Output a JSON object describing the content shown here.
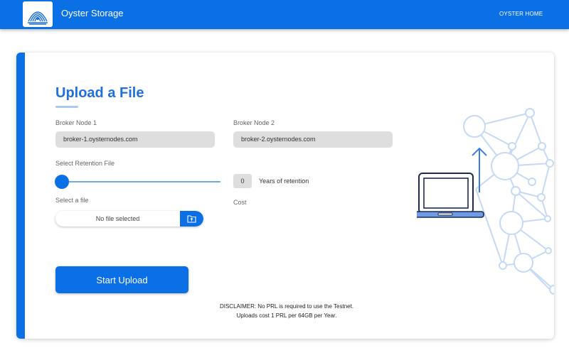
{
  "app": {
    "brand": "Oyster Storage",
    "home_link": "OYSTER HOME",
    "logo_icon": "oyster-logo"
  },
  "form": {
    "title": "Upload a File",
    "broker1_label": "Broker Node 1",
    "broker1_value": "broker-1.oysternodes.com",
    "broker2_label": "Broker Node 2",
    "broker2_value": "broker-2.oysternodes.com",
    "retention_label": "Select Retention File",
    "retention_value": 0,
    "years": "0",
    "years_label": "Years of retention",
    "select_file_label": "Select a file",
    "file_status": "No file selected",
    "file_button_icon": "folder-upload-icon",
    "cost_label": "Cost",
    "start_button": "Start Upload"
  },
  "disclaimer": {
    "line1": "DISCLAIMER: No PRL is required to use the Testnet.",
    "line2": "Uploads cost 1 PRL per 64GB per Year."
  },
  "colors": {
    "primary": "#0b6fe6",
    "title": "#1f6fdc",
    "illustration_lines": "#c6d9f4"
  },
  "illustration": {
    "icon": "laptop-upload-network-illustration"
  }
}
